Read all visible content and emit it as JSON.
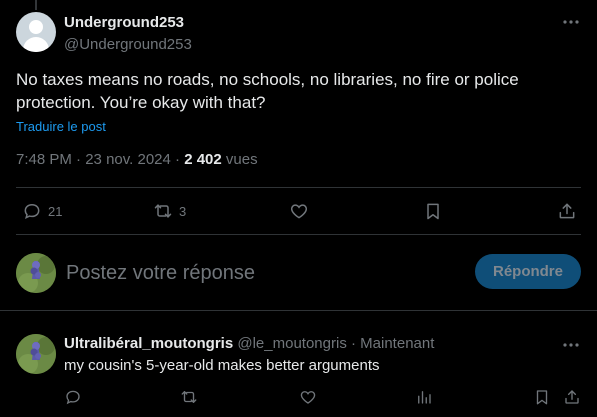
{
  "tweet": {
    "display_name": "Underground253",
    "handle": "@Underground253",
    "text": "No taxes means no roads, no schools, no libraries, no fire or police protection. You’re okay with that?",
    "translate_label": "Traduire le post",
    "time": "7:48 PM",
    "sep1": " · ",
    "date": "23 nov. 2024",
    "sep2": " · ",
    "views_count": "2 402",
    "views_label": " vues",
    "replies_count": "21",
    "reposts_count": "3"
  },
  "reply_box": {
    "placeholder": "Postez votre réponse",
    "button_label": "Répondre"
  },
  "reply_tweet": {
    "display_name": "Ultralibéral_moutongris",
    "handle": "@le_moutongris",
    "sep": " · ",
    "time": "Maintenant",
    "text": "my cousin's 5-year-old makes better arguments"
  },
  "colors": {
    "accent": "#1d9bf0",
    "muted": "#71767b",
    "text": "#e7e9ea",
    "background": "#000000"
  }
}
